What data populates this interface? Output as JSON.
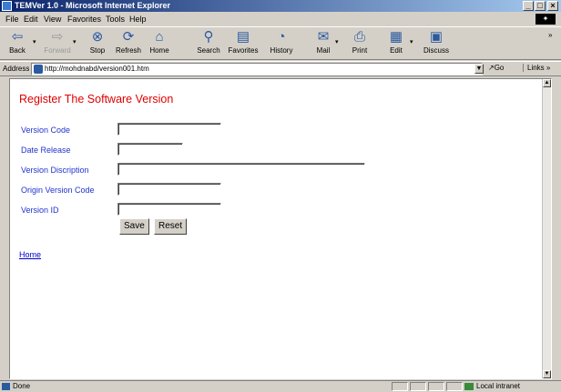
{
  "window": {
    "title": "TEMVer 1.0 - Microsoft Internet Explorer"
  },
  "menu": [
    "File",
    "Edit",
    "View",
    "Favorites",
    "Tools",
    "Help"
  ],
  "toolbar": [
    {
      "label": "Back",
      "icon": "back-arrow-icon",
      "enabled": true
    },
    {
      "label": "Forward",
      "icon": "forward-arrow-icon",
      "enabled": false
    },
    {
      "label": "Stop",
      "icon": "stop-icon",
      "enabled": true
    },
    {
      "label": "Refresh",
      "icon": "refresh-icon",
      "enabled": true
    },
    {
      "label": "Home",
      "icon": "home-icon",
      "enabled": true
    },
    {
      "label": "Search",
      "icon": "search-icon",
      "enabled": true
    },
    {
      "label": "Favorites",
      "icon": "favorites-icon",
      "enabled": true
    },
    {
      "label": "History",
      "icon": "history-icon",
      "enabled": true
    },
    {
      "label": "Mail",
      "icon": "mail-icon",
      "enabled": true
    },
    {
      "label": "Print",
      "icon": "print-icon",
      "enabled": true
    },
    {
      "label": "Edit",
      "icon": "edit-icon",
      "enabled": true
    },
    {
      "label": "Discuss",
      "icon": "discuss-icon",
      "enabled": true
    }
  ],
  "address": {
    "label": "Address",
    "url": "http://mohdnabd/version001.htm",
    "go_label": "Go",
    "links_label": "Links"
  },
  "page": {
    "heading": "Register The Software Version",
    "fields": [
      {
        "label": "Version Code",
        "value": ""
      },
      {
        "label": "Date Release",
        "value": ""
      },
      {
        "label": "Version Discription",
        "value": ""
      },
      {
        "label": "Origin Version Code",
        "value": ""
      },
      {
        "label": "Version ID",
        "value": ""
      }
    ],
    "save_label": "Save",
    "reset_label": "Reset",
    "home_link": "Home"
  },
  "status": {
    "text": "Done",
    "zone": "Local intranet"
  },
  "colors": {
    "heading": "#e00000",
    "label": "#2233cc",
    "link": "#0000cc",
    "titlebar_start": "#0a246a",
    "titlebar_end": "#a6caf0"
  }
}
